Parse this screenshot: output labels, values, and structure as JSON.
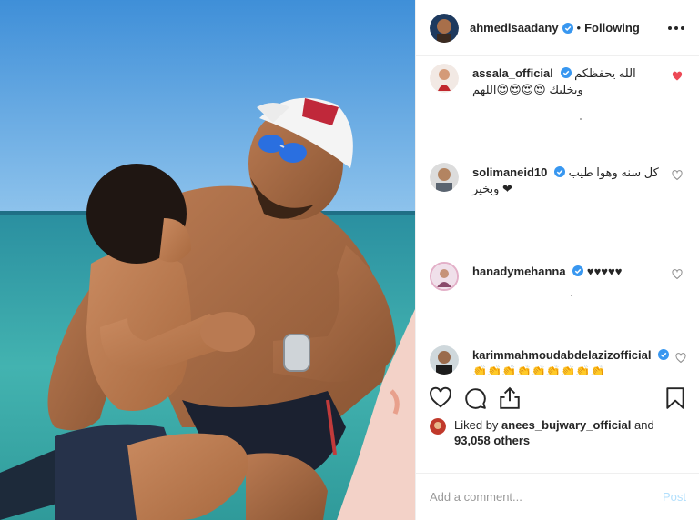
{
  "colors": {
    "text": "#262626",
    "border": "#efefef",
    "verified": "#3897f0",
    "like_red": "#ed4956",
    "post_disabled": "#b2dffc",
    "placeholder": "#999999"
  },
  "header": {
    "username": "ahmedlsaadany",
    "verified_icon": "verified-badge-icon",
    "separator": "•",
    "follow_status": "Following",
    "more_icon": "more-options-icon"
  },
  "comments": [
    {
      "username": "assala_official",
      "verified": true,
      "text": "الله يحفظكم ويخليك 😍😍😍😍اللهم",
      "liked": true
    },
    {
      "username": "solimaneid10",
      "verified": true,
      "text": "كل سنه وهوا طيب وبخير ❤",
      "liked": false
    },
    {
      "username": "hanadymehanna",
      "verified": true,
      "text": "♥♥♥♥♥",
      "liked": false
    },
    {
      "username": "karimmahmoudabdelazizofficial",
      "verified": true,
      "text": "👏👏👏👏👏👏👏👏👏",
      "liked": false
    }
  ],
  "actions": {
    "like_icon": "heart-icon",
    "comment_icon": "comment-icon",
    "share_icon": "share-icon",
    "save_icon": "bookmark-icon"
  },
  "likes": {
    "prefix": "Liked by",
    "user": "anees_bujwary_official",
    "conj": "and",
    "count": "93,058 others"
  },
  "add_comment": {
    "placeholder": "Add a comment...",
    "post_label": "Post"
  }
}
